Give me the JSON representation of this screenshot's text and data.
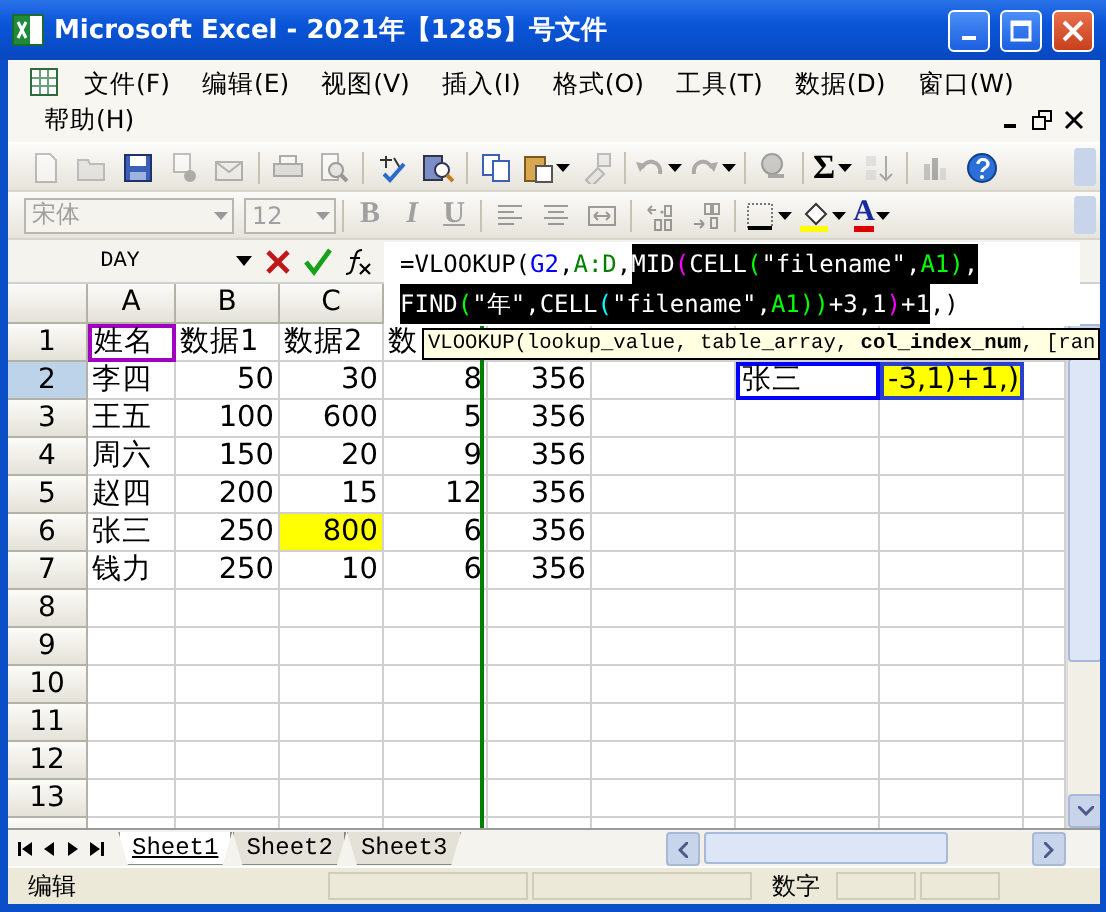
{
  "window": {
    "title": "Microsoft Excel - 2021年【1285】号文件"
  },
  "menu": [
    "文件(F)",
    "编辑(E)",
    "视图(V)",
    "插入(I)",
    "格式(O)",
    "工具(T)",
    "数据(D)",
    "窗口(W)",
    "帮助(H)"
  ],
  "standard_toolbar": [
    {
      "kind": "new",
      "disabled": true
    },
    {
      "kind": "open",
      "disabled": true
    },
    {
      "kind": "save",
      "disabled": false
    },
    {
      "kind": "permission",
      "disabled": true
    },
    {
      "kind": "email",
      "disabled": true
    },
    {
      "kind": "print",
      "disabled": true
    },
    {
      "kind": "preview",
      "disabled": true
    },
    {
      "kind": "spelling",
      "disabled": false
    },
    {
      "kind": "research",
      "disabled": false
    },
    {
      "kind": "copy",
      "disabled": false
    },
    {
      "kind": "paste",
      "disabled": false,
      "dropdown": true
    },
    {
      "kind": "painter",
      "disabled": true
    },
    {
      "kind": "undo",
      "disabled": true,
      "dropdown": true
    },
    {
      "kind": "redo",
      "disabled": true,
      "dropdown": true
    },
    {
      "kind": "hyperlink",
      "disabled": true
    },
    {
      "kind": "autosum",
      "label": "Σ",
      "disabled": false,
      "dropdown": true
    },
    {
      "kind": "sort",
      "disabled": true
    },
    {
      "kind": "chart",
      "disabled": true
    },
    {
      "kind": "help",
      "disabled": false
    }
  ],
  "formatting_toolbar": [
    {
      "kind": "font-box",
      "value": "宋体",
      "disabled": true
    },
    {
      "kind": "size-box",
      "value": "12",
      "disabled": true
    },
    {
      "kind": "bold",
      "label": "B",
      "disabled": true
    },
    {
      "kind": "italic",
      "label": "I",
      "disabled": true
    },
    {
      "kind": "underline",
      "label": "U",
      "disabled": true
    },
    {
      "kind": "align-left",
      "disabled": true
    },
    {
      "kind": "center",
      "disabled": true
    },
    {
      "kind": "merge",
      "disabled": true
    },
    {
      "kind": "inc-decimal",
      "disabled": true
    },
    {
      "kind": "dec-decimal",
      "disabled": true
    },
    {
      "kind": "borders",
      "disabled": false,
      "dropdown": true
    },
    {
      "kind": "fill-color",
      "disabled": false,
      "dropdown": true
    },
    {
      "kind": "font-color",
      "label": "A",
      "disabled": false,
      "dropdown": true
    }
  ],
  "name_box": "DAY",
  "formula": [
    [
      {
        "text": "=VLOOKUP(",
        "highlighted": false
      },
      {
        "text": "G2",
        "color": "#0000ff",
        "highlighted": false
      },
      {
        "text": ",",
        "highlighted": false
      },
      {
        "text": "A:D",
        "color": "#008000",
        "highlighted": false
      },
      {
        "text": ",",
        "highlighted": false
      },
      {
        "text": "MID",
        "highlighted": true
      },
      {
        "text": "(",
        "color": "#ff00ff",
        "highlighted": true
      },
      {
        "text": "CELL",
        "highlighted": true
      },
      {
        "text": "(",
        "color": "#00ff00",
        "highlighted": true
      },
      {
        "text": "\"filename\",",
        "highlighted": true
      },
      {
        "text": "A1",
        "color": "#00ff00",
        "highlighted": true
      },
      {
        "text": ")",
        "color": "#00ff00",
        "highlighted": true
      },
      {
        "text": ",",
        "highlighted": true
      }
    ],
    [
      {
        "text": "FIND",
        "highlighted": true
      },
      {
        "text": "(",
        "color": "#00ff00",
        "highlighted": true
      },
      {
        "text": "\"年\",CELL",
        "highlighted": true
      },
      {
        "text": "(",
        "color": "#00ffff",
        "highlighted": true
      },
      {
        "text": "\"filename\",",
        "highlighted": true
      },
      {
        "text": "A1",
        "color": "#00ff00",
        "highlighted": true
      },
      {
        "text": "))",
        "color": "#00ff00",
        "highlighted": true
      },
      {
        "text": "+3,1",
        "highlighted": true
      },
      {
        "text": ")",
        "color": "#ff00ff",
        "highlighted": true
      },
      {
        "text": "+1",
        "highlighted": true
      },
      {
        "text": ",)",
        "highlighted": false
      }
    ]
  ],
  "tooltip": "VLOOKUP(lookup_value, table_array, **col_index_num**, [ran",
  "columns": [
    "A",
    "B",
    "C"
  ],
  "rows": [
    {
      "header": "1",
      "selected": false,
      "cells": [
        {
          "text": "姓名",
          "kind": "reference",
          "color": "#a000c0"
        },
        {
          "text": "数据1",
          "kind": "text"
        },
        {
          "text": "数据2",
          "kind": "text"
        },
        {
          "text": "数",
          "kind": "text"
        }
      ]
    },
    {
      "header": "2",
      "selected": true,
      "cells": [
        {
          "text": "李四",
          "kind": "text"
        },
        {
          "text": "50",
          "kind": "number"
        },
        {
          "text": "30",
          "kind": "number"
        },
        {
          "text": "8",
          "kind": "number"
        },
        {
          "text": "356",
          "kind": "number"
        },
        null,
        {
          "text": "张三",
          "kind": "reference",
          "color": "#0000ff"
        },
        {
          "text": "-3,1)+1,)",
          "kind": "editing",
          "color": "#ffff00"
        }
      ]
    },
    {
      "header": "3",
      "selected": false,
      "cells": [
        {
          "text": "王五",
          "kind": "text"
        },
        {
          "text": "100",
          "kind": "number"
        },
        {
          "text": "600",
          "kind": "number"
        },
        {
          "text": "5",
          "kind": "number"
        },
        {
          "text": "356",
          "kind": "number"
        }
      ]
    },
    {
      "header": "4",
      "selected": false,
      "cells": [
        {
          "text": "周六",
          "kind": "text"
        },
        {
          "text": "150",
          "kind": "number"
        },
        {
          "text": "20",
          "kind": "number"
        },
        {
          "text": "9",
          "kind": "number"
        },
        {
          "text": "356",
          "kind": "number"
        }
      ]
    },
    {
      "header": "5",
      "selected": false,
      "cells": [
        {
          "text": "赵四",
          "kind": "text"
        },
        {
          "text": "200",
          "kind": "number"
        },
        {
          "text": "15",
          "kind": "number"
        },
        {
          "text": "12",
          "kind": "number"
        },
        {
          "text": "356",
          "kind": "number"
        }
      ]
    },
    {
      "header": "6",
      "selected": false,
      "cells": [
        {
          "text": "张三",
          "kind": "text"
        },
        {
          "text": "250",
          "kind": "number"
        },
        {
          "text": "800",
          "kind": "number",
          "color": "#ffff00"
        },
        {
          "text": "6",
          "kind": "number"
        },
        {
          "text": "356",
          "kind": "number"
        }
      ]
    },
    {
      "header": "7",
      "selected": false,
      "cells": [
        {
          "text": "钱力",
          "kind": "text"
        },
        {
          "text": "250",
          "kind": "number"
        },
        {
          "text": "10",
          "kind": "number"
        },
        {
          "text": "6",
          "kind": "number"
        },
        {
          "text": "356",
          "kind": "number"
        }
      ]
    },
    {
      "header": "8",
      "selected": false
    },
    {
      "header": "9",
      "selected": false
    },
    {
      "header": "10",
      "selected": false
    },
    {
      "header": "11",
      "selected": false
    },
    {
      "header": "12",
      "selected": false
    },
    {
      "header": "13",
      "selected": false
    }
  ],
  "sheet_tabs": [
    {
      "label": "Sheet1",
      "selected": true
    },
    {
      "label": "Sheet2",
      "selected": false
    },
    {
      "label": "Sheet3",
      "selected": false
    }
  ],
  "status_bar": {
    "mode": "编辑",
    "indicator": "数字"
  }
}
